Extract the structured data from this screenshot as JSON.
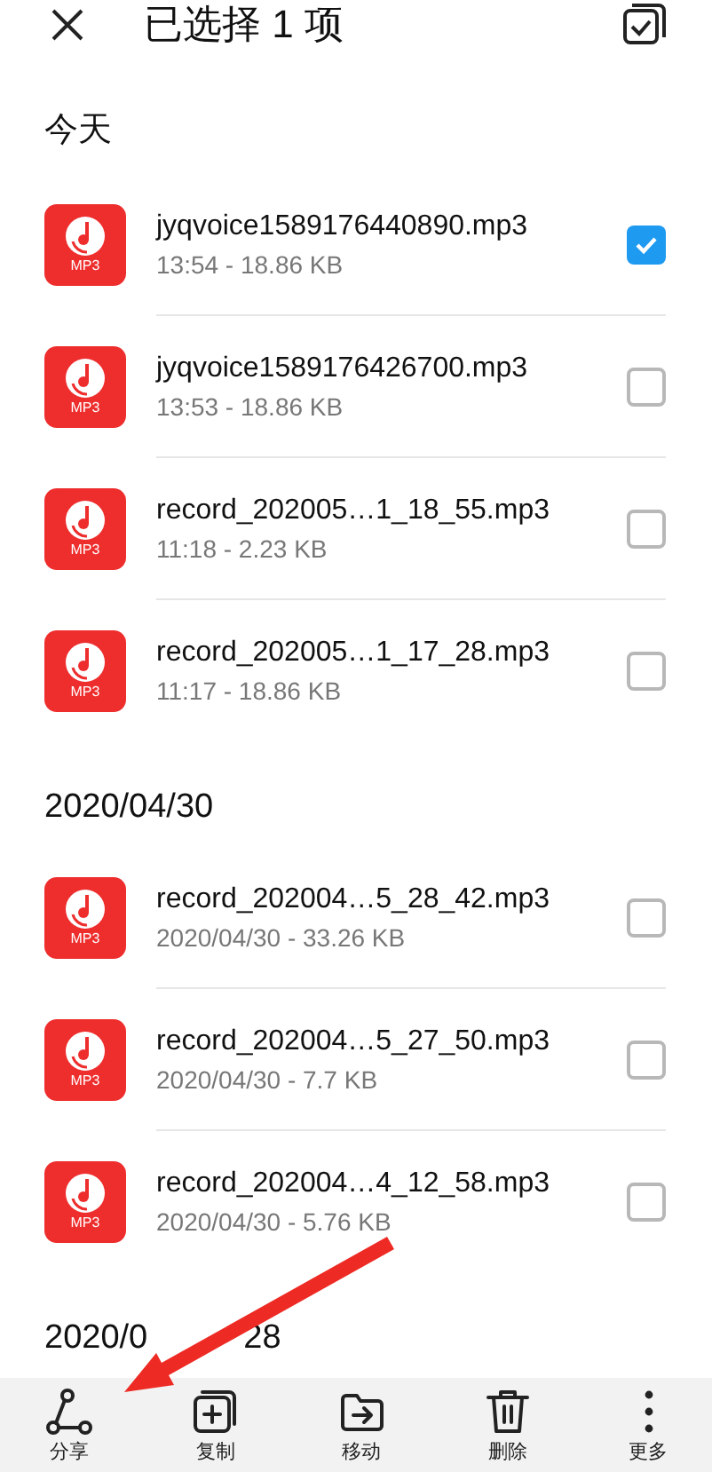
{
  "header": {
    "title": "已选择 1 项"
  },
  "sections": [
    {
      "label": "今天",
      "files": [
        {
          "name": "jyqvoice1589176440890.mp3",
          "meta": "13:54 - 18.86 KB",
          "badge": "MP3",
          "checked": true
        },
        {
          "name": "jyqvoice1589176426700.mp3",
          "meta": "13:53 - 18.86 KB",
          "badge": "MP3",
          "checked": false
        },
        {
          "name": "record_202005…1_18_55.mp3",
          "meta": "11:18 - 2.23 KB",
          "badge": "MP3",
          "checked": false
        },
        {
          "name": "record_202005…1_17_28.mp3",
          "meta": "11:17 - 18.86 KB",
          "badge": "MP3",
          "checked": false
        }
      ]
    },
    {
      "label": "2020/04/30",
      "files": [
        {
          "name": "record_202004…5_28_42.mp3",
          "meta": "2020/04/30 - 33.26 KB",
          "badge": "MP3",
          "checked": false
        },
        {
          "name": "record_202004…5_27_50.mp3",
          "meta": "2020/04/30 - 7.7 KB",
          "badge": "MP3",
          "checked": false
        },
        {
          "name": "record_202004…4_12_58.mp3",
          "meta": "2020/04/30 - 5.76 KB",
          "badge": "MP3",
          "checked": false
        }
      ]
    },
    {
      "label": "2020/0",
      "label_after_arrow": "28"
    }
  ],
  "toolbar": [
    {
      "kind": "share",
      "label": "分享"
    },
    {
      "kind": "copy",
      "label": "复制"
    },
    {
      "kind": "move",
      "label": "移动"
    },
    {
      "kind": "delete",
      "label": "删除"
    },
    {
      "kind": "more",
      "label": "更多"
    }
  ]
}
